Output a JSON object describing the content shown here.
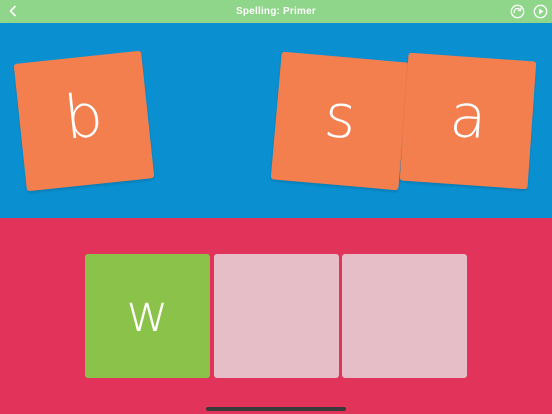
{
  "header": {
    "title": "Spelling: Primer",
    "back_icon": "chevron-left-icon",
    "redo_icon": "redo-circle-icon",
    "play_icon": "play-circle-icon"
  },
  "letter_tiles": [
    {
      "letter": "b"
    },
    {
      "letter": "s"
    },
    {
      "letter": "a"
    }
  ],
  "answer_slots": [
    {
      "letter": "w",
      "state": "filled"
    },
    {
      "letter": "",
      "state": "empty"
    },
    {
      "letter": "",
      "state": "empty"
    }
  ],
  "colors": {
    "header_bg": "#8fd68a",
    "letters_bg": "#0a8fd0",
    "tile": "#f47f4e",
    "answer_bg": "#e2335b",
    "filled_slot": "#8bc34a",
    "empty_slot": "#e5bec7"
  }
}
